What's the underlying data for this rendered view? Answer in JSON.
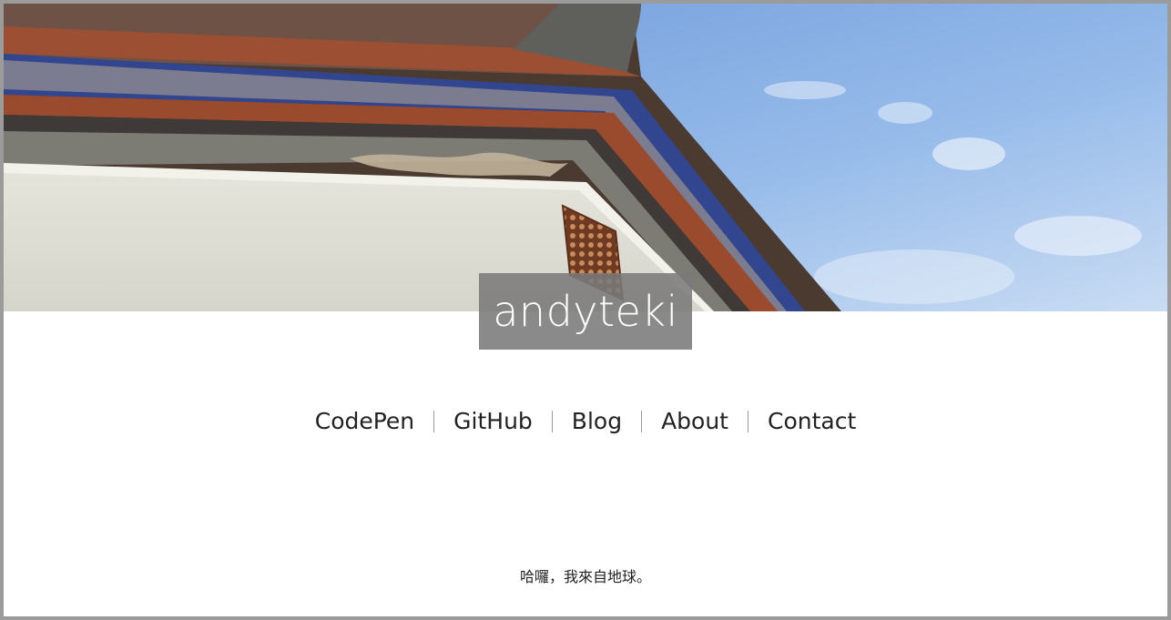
{
  "header": {
    "site_title": "andyteki",
    "hero_image": "traditional-roof-eave-against-blue-sky"
  },
  "nav": {
    "items": [
      {
        "label": "CodePen"
      },
      {
        "label": "GitHub"
      },
      {
        "label": "Blog"
      },
      {
        "label": "About"
      },
      {
        "label": "Contact"
      }
    ]
  },
  "footer": {
    "tagline": "哈囉，我來自地球。"
  },
  "colors": {
    "frame_border": "#9b9b9b",
    "title_badge_bg": "#7a7a7a",
    "text": "#222222",
    "sky": "#8fb4e6"
  }
}
